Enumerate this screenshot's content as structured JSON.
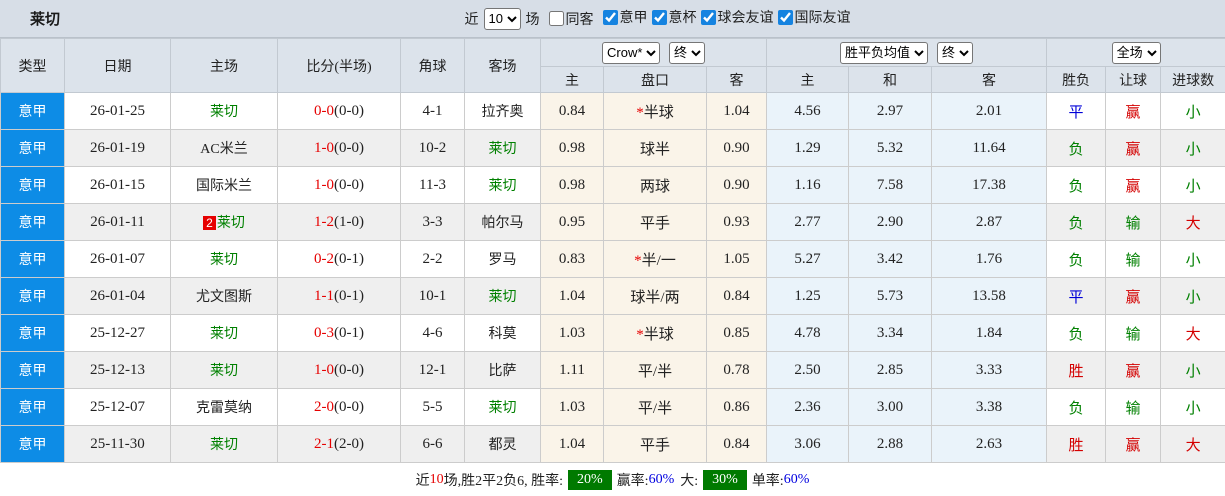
{
  "header": {
    "title": "莱切",
    "recent_label": "近",
    "recent_value": "10",
    "matches_label": "场",
    "same_venue": {
      "label": "同客",
      "checked": false
    },
    "filters": [
      {
        "label": "意甲",
        "checked": true
      },
      {
        "label": "意杯",
        "checked": true
      },
      {
        "label": "球会友谊",
        "checked": true
      },
      {
        "label": "国际友谊",
        "checked": true
      }
    ]
  },
  "table": {
    "selects": {
      "odds_source": "Crow*",
      "odds_time": "终",
      "avg_source": "胜平负均值",
      "avg_time": "终",
      "scope": "全场"
    },
    "headers": {
      "type": "类型",
      "date": "日期",
      "home": "主场",
      "score": "比分(半场)",
      "corner": "角球",
      "away": "客场",
      "odds_home": "主",
      "odds_line": "盘口",
      "odds_away": "客",
      "avg_home": "主",
      "avg_draw": "和",
      "avg_away": "客",
      "result": "胜负",
      "handicap": "让球",
      "goals": "进球数"
    },
    "rows": [
      {
        "league": "意甲",
        "date": "26-01-25",
        "home": "莱切",
        "home_focus": true,
        "home_badge": "",
        "score": "0-0",
        "half": "(0-0)",
        "corner": "4-1",
        "away": "拉齐奥",
        "away_focus": false,
        "odds_home": "0.84",
        "line_star": true,
        "line": "半球",
        "odds_away": "1.04",
        "avg_home": "4.56",
        "avg_draw": "2.97",
        "avg_away": "2.01",
        "result": "平",
        "result_color": "blue",
        "handicap": "赢",
        "handicap_color": "red",
        "goals": "小",
        "goals_color": "green"
      },
      {
        "league": "意甲",
        "date": "26-01-19",
        "home": "AC米兰",
        "home_focus": false,
        "home_badge": "",
        "score": "1-0",
        "half": "(0-0)",
        "corner": "10-2",
        "away": "莱切",
        "away_focus": true,
        "odds_home": "0.98",
        "line_star": false,
        "line": "球半",
        "odds_away": "0.90",
        "avg_home": "1.29",
        "avg_draw": "5.32",
        "avg_away": "11.64",
        "result": "负",
        "result_color": "green",
        "handicap": "赢",
        "handicap_color": "red",
        "goals": "小",
        "goals_color": "green"
      },
      {
        "league": "意甲",
        "date": "26-01-15",
        "home": "国际米兰",
        "home_focus": false,
        "home_badge": "",
        "score": "1-0",
        "half": "(0-0)",
        "corner": "11-3",
        "away": "莱切",
        "away_focus": true,
        "odds_home": "0.98",
        "line_star": false,
        "line": "两球",
        "odds_away": "0.90",
        "avg_home": "1.16",
        "avg_draw": "7.58",
        "avg_away": "17.38",
        "result": "负",
        "result_color": "green",
        "handicap": "赢",
        "handicap_color": "red",
        "goals": "小",
        "goals_color": "green"
      },
      {
        "league": "意甲",
        "date": "26-01-11",
        "home": "莱切",
        "home_focus": true,
        "home_badge": "2",
        "score": "1-2",
        "half": "(1-0)",
        "corner": "3-3",
        "away": "帕尔马",
        "away_focus": false,
        "odds_home": "0.95",
        "line_star": false,
        "line": "平手",
        "odds_away": "0.93",
        "avg_home": "2.77",
        "avg_draw": "2.90",
        "avg_away": "2.87",
        "result": "负",
        "result_color": "green",
        "handicap": "输",
        "handicap_color": "green",
        "goals": "大",
        "goals_color": "red"
      },
      {
        "league": "意甲",
        "date": "26-01-07",
        "home": "莱切",
        "home_focus": true,
        "home_badge": "",
        "score": "0-2",
        "half": "(0-1)",
        "corner": "2-2",
        "away": "罗马",
        "away_focus": false,
        "odds_home": "0.83",
        "line_star": true,
        "line": "半/一",
        "odds_away": "1.05",
        "avg_home": "5.27",
        "avg_draw": "3.42",
        "avg_away": "1.76",
        "result": "负",
        "result_color": "green",
        "handicap": "输",
        "handicap_color": "green",
        "goals": "小",
        "goals_color": "green"
      },
      {
        "league": "意甲",
        "date": "26-01-04",
        "home": "尤文图斯",
        "home_focus": false,
        "home_badge": "",
        "score": "1-1",
        "half": "(0-1)",
        "corner": "10-1",
        "away": "莱切",
        "away_focus": true,
        "odds_home": "1.04",
        "line_star": false,
        "line": "球半/两",
        "odds_away": "0.84",
        "avg_home": "1.25",
        "avg_draw": "5.73",
        "avg_away": "13.58",
        "result": "平",
        "result_color": "blue",
        "handicap": "赢",
        "handicap_color": "red",
        "goals": "小",
        "goals_color": "green"
      },
      {
        "league": "意甲",
        "date": "25-12-27",
        "home": "莱切",
        "home_focus": true,
        "home_badge": "",
        "score": "0-3",
        "half": "(0-1)",
        "corner": "4-6",
        "away": "科莫",
        "away_focus": false,
        "odds_home": "1.03",
        "line_star": true,
        "line": "半球",
        "odds_away": "0.85",
        "avg_home": "4.78",
        "avg_draw": "3.34",
        "avg_away": "1.84",
        "result": "负",
        "result_color": "green",
        "handicap": "输",
        "handicap_color": "green",
        "goals": "大",
        "goals_color": "red"
      },
      {
        "league": "意甲",
        "date": "25-12-13",
        "home": "莱切",
        "home_focus": true,
        "home_badge": "",
        "score": "1-0",
        "half": "(0-0)",
        "corner": "12-1",
        "away": "比萨",
        "away_focus": false,
        "odds_home": "1.11",
        "line_star": false,
        "line": "平/半",
        "odds_away": "0.78",
        "avg_home": "2.50",
        "avg_draw": "2.85",
        "avg_away": "3.33",
        "result": "胜",
        "result_color": "red",
        "handicap": "赢",
        "handicap_color": "red",
        "goals": "小",
        "goals_color": "green"
      },
      {
        "league": "意甲",
        "date": "25-12-07",
        "home": "克雷莫纳",
        "home_focus": false,
        "home_badge": "",
        "score": "2-0",
        "half": "(0-0)",
        "corner": "5-5",
        "away": "莱切",
        "away_focus": true,
        "odds_home": "1.03",
        "line_star": false,
        "line": "平/半",
        "odds_away": "0.86",
        "avg_home": "2.36",
        "avg_draw": "3.00",
        "avg_away": "3.38",
        "result": "负",
        "result_color": "green",
        "handicap": "输",
        "handicap_color": "green",
        "goals": "小",
        "goals_color": "green"
      },
      {
        "league": "意甲",
        "date": "25-11-30",
        "home": "莱切",
        "home_focus": true,
        "home_badge": "",
        "score": "2-1",
        "half": "(2-0)",
        "corner": "6-6",
        "away": "都灵",
        "away_focus": false,
        "odds_home": "1.04",
        "line_star": false,
        "line": "平手",
        "odds_away": "0.84",
        "avg_home": "3.06",
        "avg_draw": "2.88",
        "avg_away": "2.63",
        "result": "胜",
        "result_color": "red",
        "handicap": "赢",
        "handicap_color": "red",
        "goals": "大",
        "goals_color": "red"
      }
    ]
  },
  "footer": {
    "prefix": "近",
    "count": "10",
    "summary": "场,胜2平2负6, 胜率:",
    "win_rate": "20%",
    "handicap_label": "赢率:",
    "handicap_rate": "60%",
    "over_label": "大:",
    "over_rate": "30%",
    "odd_label": "单率:",
    "odd_rate": "60%"
  },
  "colors": {
    "league_badge_bg": "#0d8ce6",
    "odds_cell_bg": "#faf4e9",
    "avg_cell_bg": "#eaf3fa",
    "win_red": "#d40000",
    "lose_green": "#008000",
    "draw_blue": "#0000d8",
    "rate_badge_bg": "#007a00",
    "rate_blue": "#0000e0"
  }
}
